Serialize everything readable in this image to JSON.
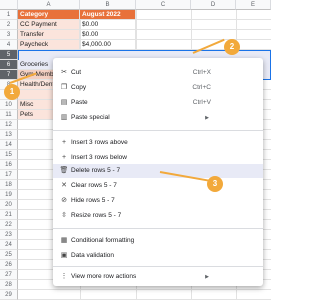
{
  "columns": [
    "A",
    "B",
    "C",
    "D",
    "E"
  ],
  "rows": [
    "1",
    "2",
    "3",
    "4",
    "5",
    "6",
    "7",
    "8",
    "9",
    "10",
    "11",
    "12",
    "13",
    "14",
    "15",
    "16",
    "17",
    "18",
    "19",
    "20",
    "21",
    "22",
    "23",
    "24",
    "25",
    "26",
    "27",
    "28",
    "29"
  ],
  "cells": {
    "a1": "Category",
    "b1": "August 2022",
    "a2": "CC Payment",
    "b2": "$0.00",
    "a3": "Transfer",
    "b3": "$0.00",
    "a4": "Paycheck",
    "b4": "$4,000.00",
    "a6": "Groceries",
    "a7": "Gym Membership",
    "a8": "Health/Dental",
    "a10": "Misc",
    "a11": "Pets"
  },
  "menu": {
    "cut": {
      "label": "Cut",
      "shortcut": "Ctrl+X"
    },
    "copy": {
      "label": "Copy",
      "shortcut": "Ctrl+C"
    },
    "paste": {
      "label": "Paste",
      "shortcut": "Ctrl+V"
    },
    "paste_special": {
      "label": "Paste special"
    },
    "insert_above": {
      "label": "Insert 3 rows above"
    },
    "insert_below": {
      "label": "Insert 3 rows below"
    },
    "delete_rows": {
      "label": "Delete rows 5 - 7"
    },
    "clear_rows": {
      "label": "Clear rows 5 - 7"
    },
    "hide_rows": {
      "label": "Hide rows 5 - 7"
    },
    "resize_rows": {
      "label": "Resize rows 5 - 7"
    },
    "conditional": {
      "label": "Conditional formatting"
    },
    "validation": {
      "label": "Data validation"
    },
    "more": {
      "label": "View more row actions"
    }
  },
  "badges": {
    "one": "1",
    "two": "2",
    "three": "3"
  },
  "colors": {
    "header": "#e8713a",
    "pink": "#fbe4dc",
    "selection": "#e8eaf6",
    "badge": "#f2a93b"
  }
}
